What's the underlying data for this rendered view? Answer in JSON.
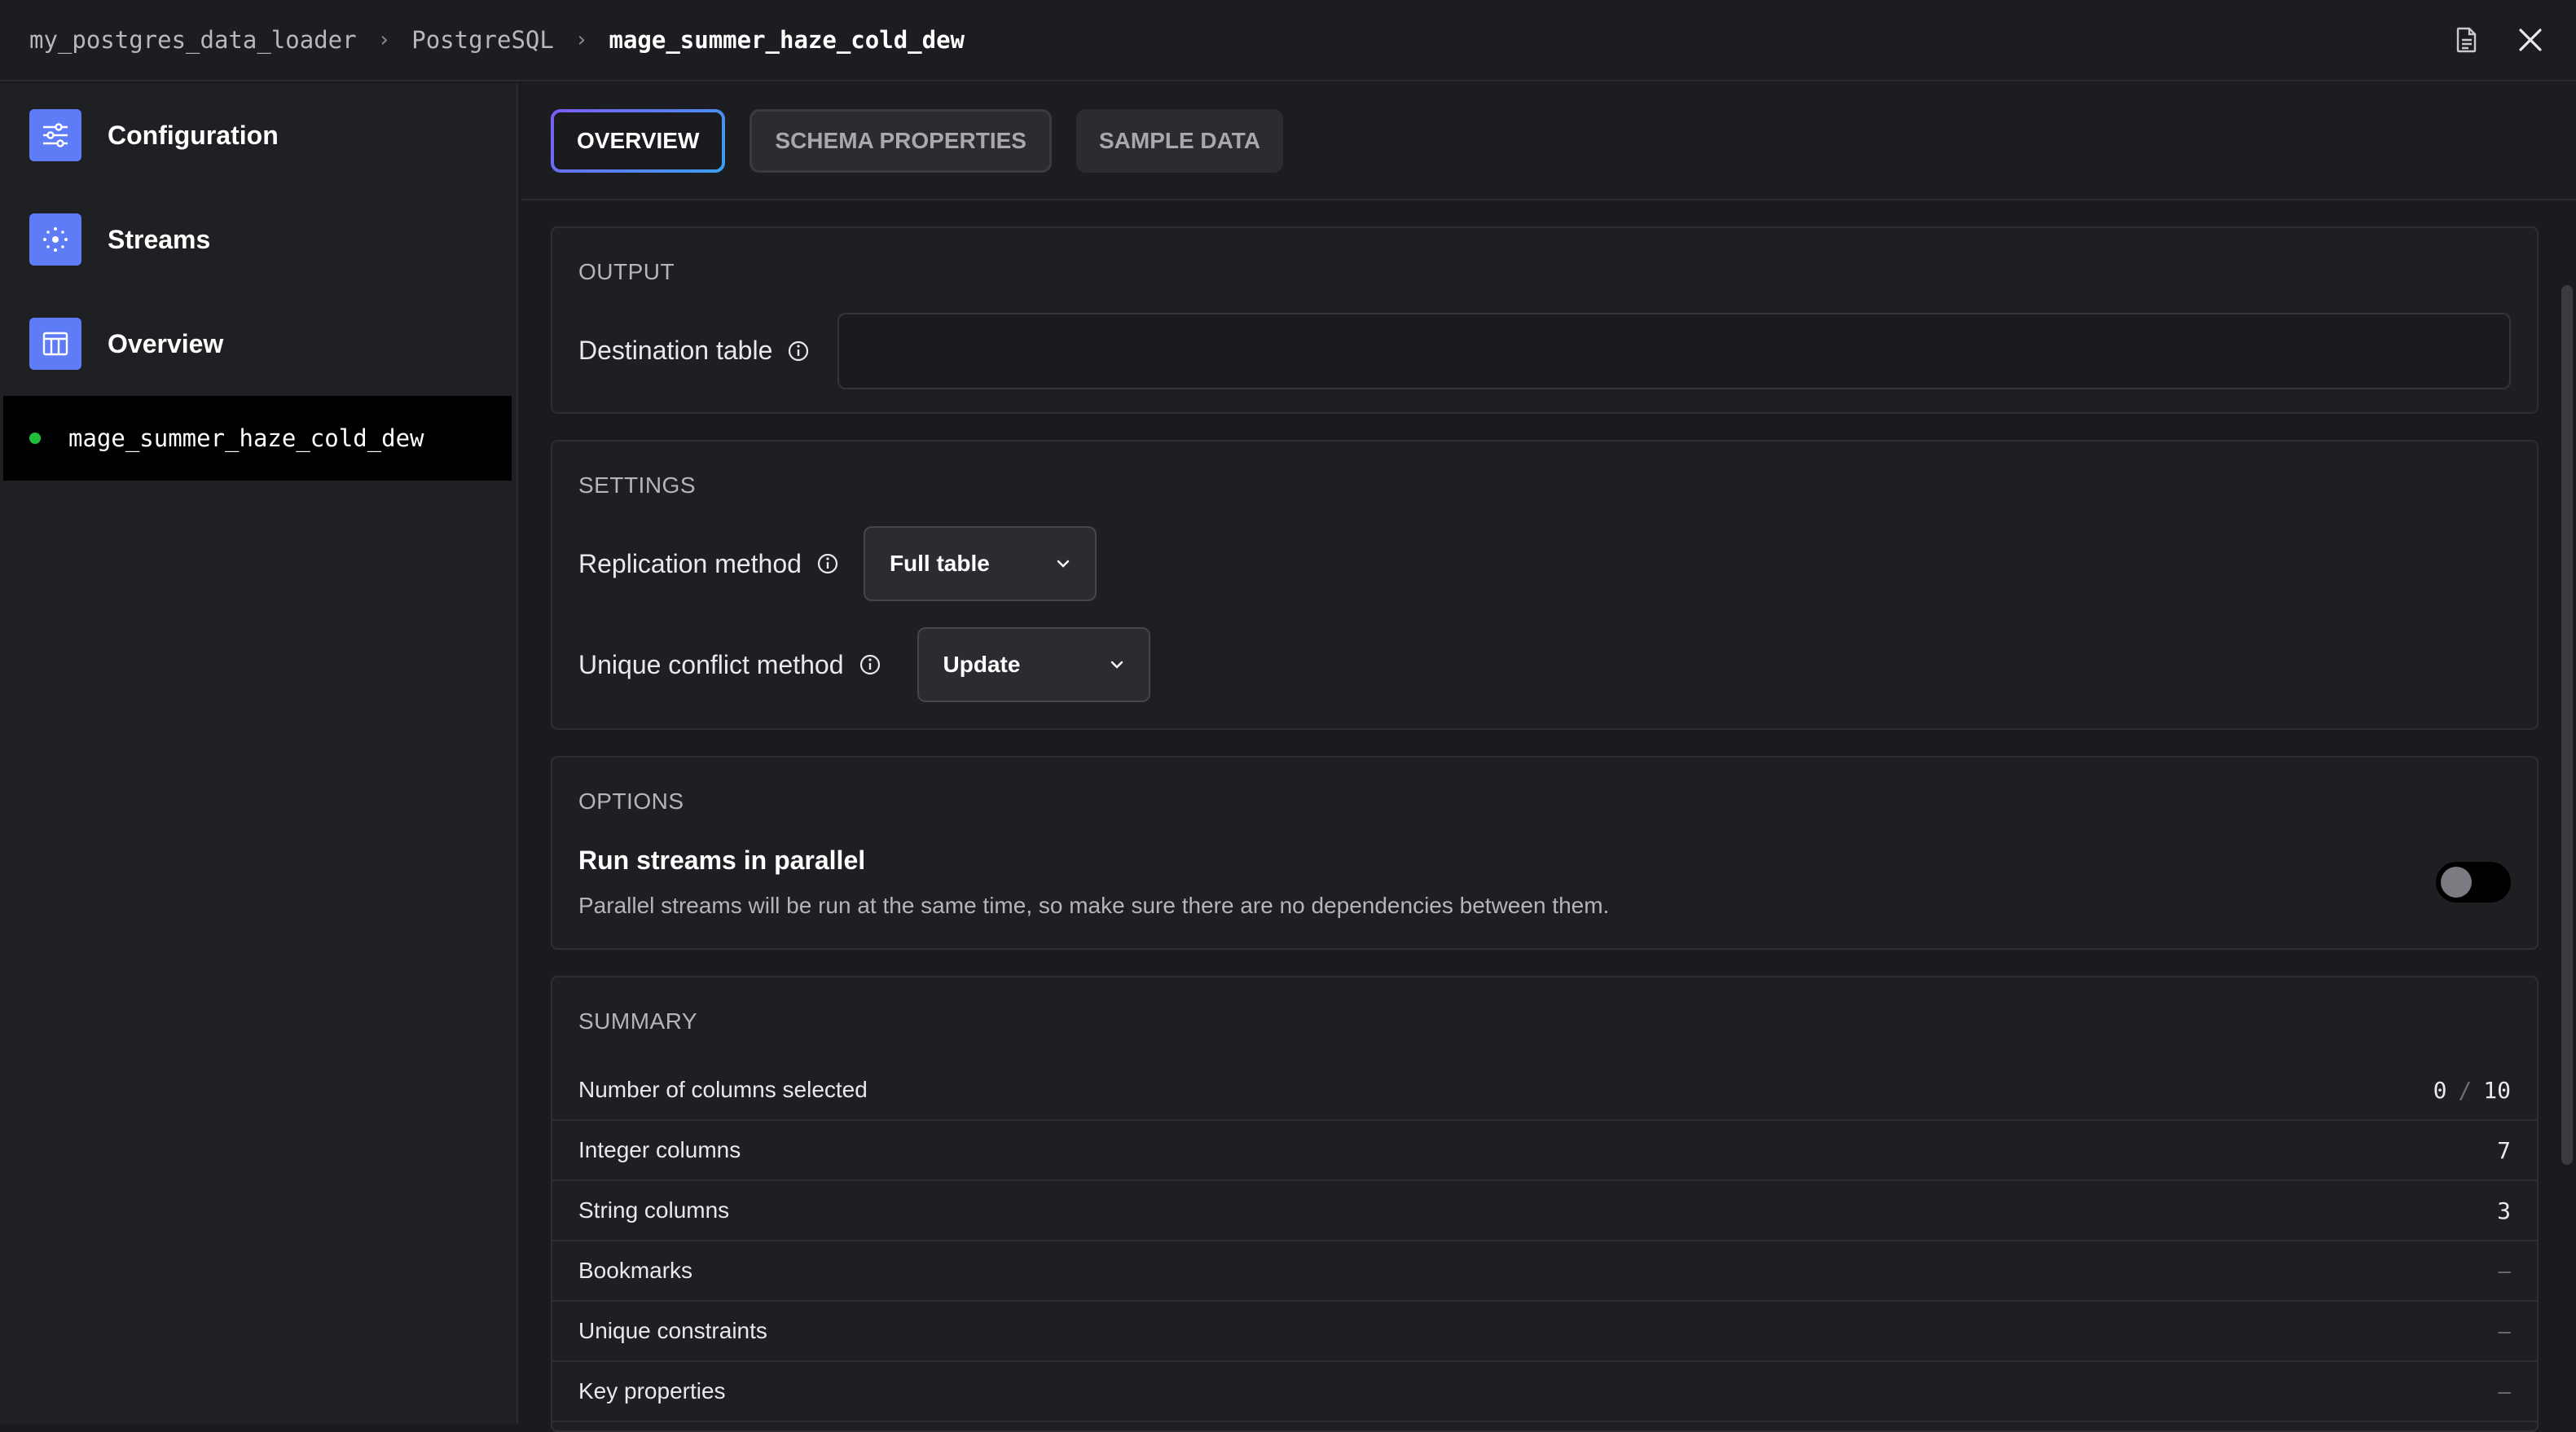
{
  "breadcrumb": {
    "items": [
      "my_postgres_data_loader",
      "PostgreSQL",
      "mage_summer_haze_cold_dew"
    ]
  },
  "sidebar": {
    "items": [
      {
        "label": "Configuration",
        "icon": "sliders-icon"
      },
      {
        "label": "Streams",
        "icon": "streams-icon"
      },
      {
        "label": "Overview",
        "icon": "table-icon"
      }
    ],
    "stream": {
      "name": "mage_summer_haze_cold_dew",
      "status_color": "#1fbf3c"
    }
  },
  "tabs": [
    {
      "label": "OVERVIEW",
      "active": true
    },
    {
      "label": "SCHEMA PROPERTIES",
      "active": false
    },
    {
      "label": "SAMPLE DATA",
      "active": false
    }
  ],
  "output": {
    "title": "OUTPUT",
    "destination_label": "Destination table",
    "destination_value": ""
  },
  "settings": {
    "title": "SETTINGS",
    "replication_label": "Replication method",
    "replication_value": "Full table",
    "unique_conflict_label": "Unique conflict method",
    "unique_conflict_value": "Update"
  },
  "options": {
    "title": "OPTIONS",
    "parallel_title": "Run streams in parallel",
    "parallel_desc": "Parallel streams will be run at the same time, so make sure there are no dependencies between them.",
    "parallel_enabled": false
  },
  "summary": {
    "title": "SUMMARY",
    "rows": [
      {
        "label": "Number of columns selected",
        "selected": "0",
        "total": "10"
      },
      {
        "label": "Integer columns",
        "value": "7"
      },
      {
        "label": "String columns",
        "value": "3"
      },
      {
        "label": "Bookmarks",
        "value": "–"
      },
      {
        "label": "Unique constraints",
        "value": "–"
      },
      {
        "label": "Key properties",
        "value": "–"
      }
    ]
  },
  "colors": {
    "accent": "#5f7cf7",
    "tab_gradient_start": "#7c5cf5",
    "tab_gradient_end": "#3aa0f0"
  }
}
